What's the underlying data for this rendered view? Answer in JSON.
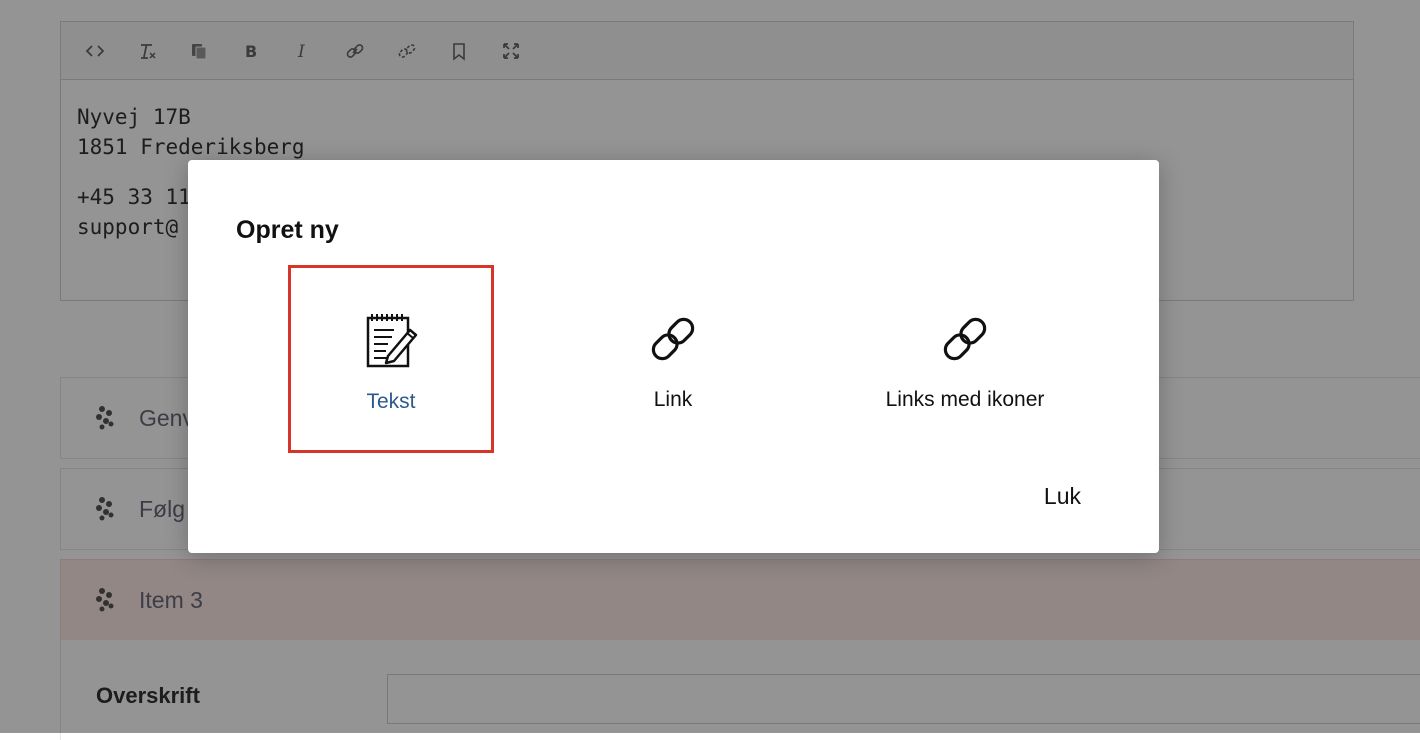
{
  "editor": {
    "toolbar": [
      {
        "name": "source-code-icon",
        "glyph": "‹›"
      },
      {
        "name": "clear-format-icon",
        "glyph": "Tx"
      },
      {
        "name": "paste-icon",
        "glyph": "⧉"
      },
      {
        "name": "bold-icon",
        "glyph": "B"
      },
      {
        "name": "italic-icon",
        "glyph": "I"
      },
      {
        "name": "link-icon",
        "glyph": ""
      },
      {
        "name": "unlink-icon",
        "glyph": ""
      },
      {
        "name": "bookmark-icon",
        "glyph": ""
      },
      {
        "name": "fullscreen-icon",
        "glyph": ""
      }
    ],
    "lines": [
      "Nyvej 17B",
      "1851 Frederiksberg",
      "",
      "+45 33 11",
      "support@"
    ]
  },
  "rows": [
    {
      "label": "Genv"
    },
    {
      "label": "Følg"
    },
    {
      "label": "Item 3"
    }
  ],
  "field": {
    "label": "Overskrift",
    "value": ""
  },
  "modal": {
    "title": "Opret ny",
    "options": [
      {
        "label": "Tekst",
        "icon": "notepad-icon",
        "selected": true
      },
      {
        "label": "Link",
        "icon": "link-icon",
        "selected": false
      },
      {
        "label": "Links med ikoner",
        "icon": "link-icon",
        "selected": false
      }
    ],
    "close_label": "Luk"
  },
  "colors": {
    "selected_border": "#d8352a",
    "selected_label": "#2d5a8e",
    "highlight_row": "#fbe9e6"
  }
}
